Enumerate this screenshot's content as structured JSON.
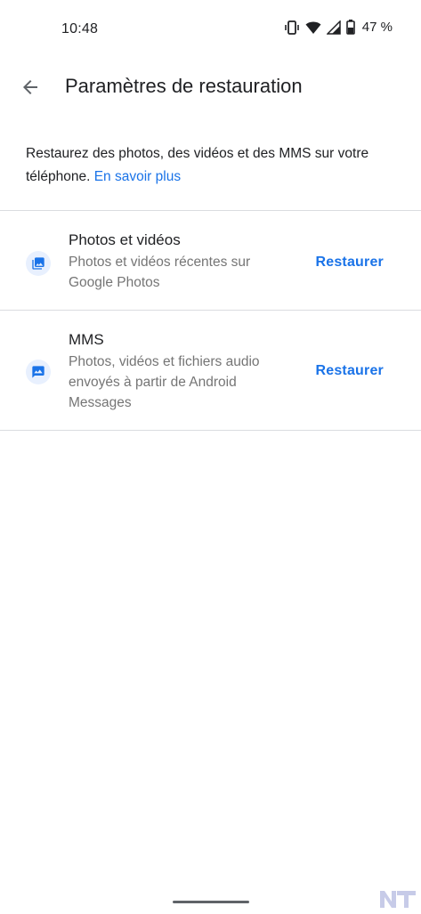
{
  "status_bar": {
    "time": "10:48",
    "battery_percent": "47 %",
    "icons": [
      "vibrate-icon",
      "wifi-icon",
      "signal-icon",
      "battery-icon"
    ]
  },
  "app_bar": {
    "title": "Paramètres de restauration",
    "back_icon": "arrow-back-icon"
  },
  "description": {
    "text": "Restaurez des photos, des vidéos et des MMS sur votre téléphone.",
    "link_label": "En savoir plus"
  },
  "items": [
    {
      "title": "Photos et vidéos",
      "subtitle": "Photos et vidéos récentes sur Google Photos",
      "action": "Restaurer",
      "icon": "photo-library-icon"
    },
    {
      "title": "MMS",
      "subtitle": "Photos, vidéos et fichiers audio envoyés à partir de Android Messages",
      "action": "Restaurer",
      "icon": "message-image-icon"
    }
  ],
  "colors": {
    "accent": "#1a73e8",
    "icon_bg": "#e8f0fe",
    "divider": "#dadce0",
    "secondary_text": "#757575"
  },
  "watermark": {
    "text": "NT"
  }
}
